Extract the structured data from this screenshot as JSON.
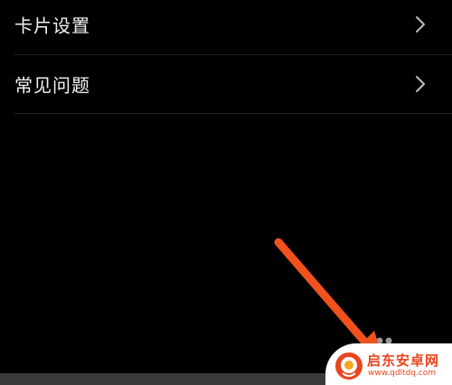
{
  "menu": {
    "items": [
      {
        "label": "卡片设置",
        "icon": "chevron-right-icon"
      },
      {
        "label": "常见问题",
        "icon": "chevron-right-icon"
      }
    ]
  },
  "colors": {
    "background": "#000000",
    "text": "#f2f2f2",
    "chevron": "#bdbdbd",
    "divider": "#1e1e1e",
    "arrow": "#f0511d",
    "watermark_brand": "#e8451f"
  },
  "watermark": {
    "name": "启东安卓网",
    "url": "www.qdltdq.com",
    "icon": "brand-logo-icon"
  },
  "annotation": {
    "icon": "pointer-arrow-icon"
  }
}
